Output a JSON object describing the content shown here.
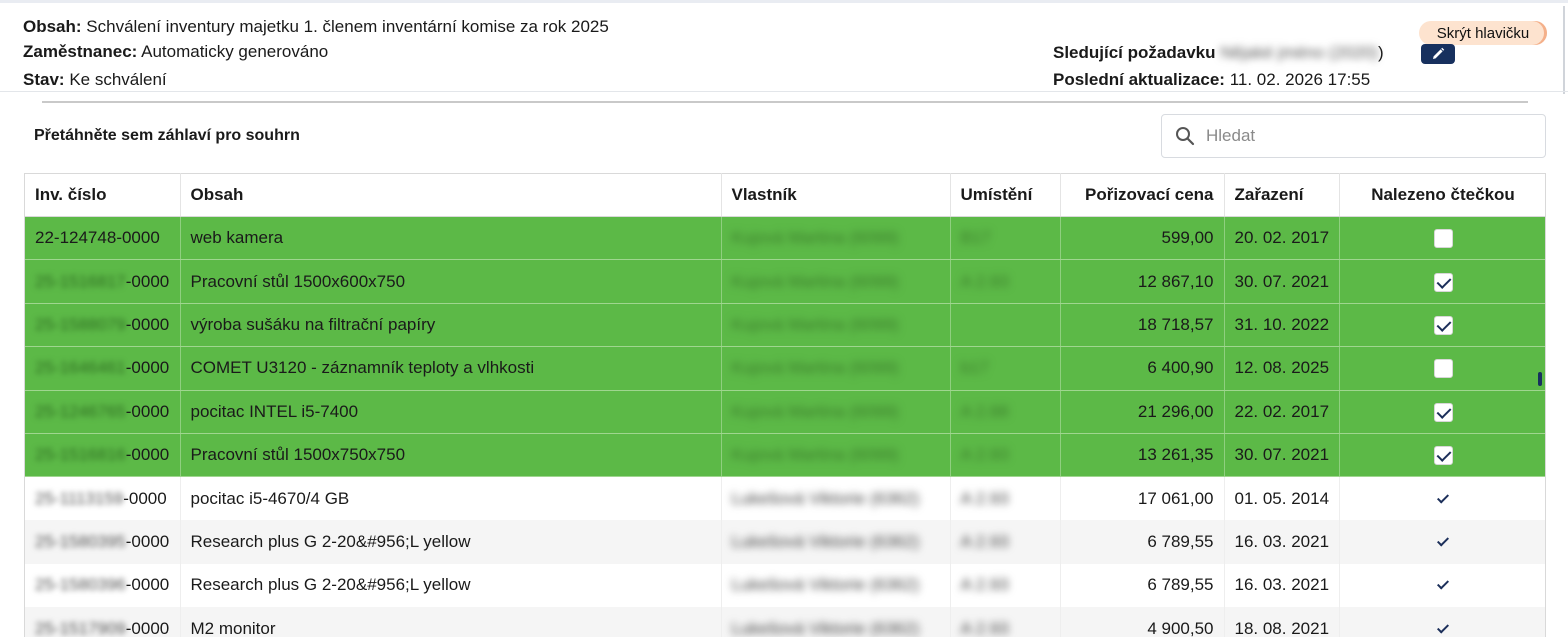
{
  "header": {
    "obsah_label": "Obsah:",
    "obsah_value": "Schválení inventury majetku 1. členem inventární komise za rok 2025",
    "zamestnanec_label": "Zaměstnanec:",
    "zamestnanec_value": "Automaticky generováno",
    "stav_label": "Stav:",
    "stav_value": "Ke schválení",
    "hide_button": "Skrýt hlavičku",
    "watcher_label": "Sledující požadavku",
    "watcher_value": "Nějaké jméno (2020)",
    "watcher_close_paren": ")",
    "updated_label": "Poslední aktualizace:",
    "updated_value": "11. 02. 2026 17:55"
  },
  "toolbar": {
    "group_hint": "Přetáhněte sem záhlaví pro souhrn",
    "search_placeholder": "Hledat"
  },
  "table": {
    "columns": [
      "Inv. číslo",
      "Obsah",
      "Vlastník",
      "Umístění",
      "Pořizovací cena",
      "Zařazení",
      "Nalezeno čtečkou"
    ],
    "rows": [
      {
        "inv_prefix": "22-124748",
        "inv_suffix": "-0000",
        "obsah": "web kamera",
        "vlastnik": "Kujová Martina (6099)",
        "umisteni": "B17",
        "cena": "599,00",
        "zarazeni": "20. 02. 2017",
        "nalezeno": false,
        "style": "green",
        "inv_prefix_blurred": false
      },
      {
        "inv_prefix": "25-1516817",
        "inv_suffix": "-0000",
        "obsah": "Pracovní stůl 1500x600x750",
        "vlastnik": "Kujová Martina (6099)",
        "umisteni": "A 2.93",
        "cena": "12 867,10",
        "zarazeni": "30. 07. 2021",
        "nalezeno": true,
        "style": "green",
        "inv_prefix_blurred": true
      },
      {
        "inv_prefix": "25-1588079",
        "inv_suffix": "-0000",
        "obsah": "výroba sušáku na filtrační papíry",
        "vlastnik": "Kujová Martina (6099)",
        "umisteni": "",
        "cena": "18 718,57",
        "zarazeni": "31. 10. 2022",
        "nalezeno": true,
        "style": "green",
        "inv_prefix_blurred": true
      },
      {
        "inv_prefix": "25-1646461",
        "inv_suffix": "-0000",
        "obsah": "COMET U3120 - záznamník teploty a vlhkosti",
        "vlastnik": "Kujová Martina (6099)",
        "umisteni": "b17",
        "cena": "6 400,90",
        "zarazeni": "12. 08. 2025",
        "nalezeno": false,
        "style": "green",
        "inv_prefix_blurred": true
      },
      {
        "inv_prefix": "25-1246765",
        "inv_suffix": "-0000",
        "obsah": "pocitac INTEL i5-7400",
        "vlastnik": "Kujová Martina (6099)",
        "umisteni": "A 2.88",
        "cena": "21 296,00",
        "zarazeni": "22. 02. 2017",
        "nalezeno": true,
        "style": "green",
        "inv_prefix_blurred": true
      },
      {
        "inv_prefix": "25-1516816",
        "inv_suffix": "-0000",
        "obsah": "Pracovní stůl 1500x750x750",
        "vlastnik": "Kujová Martina (6099)",
        "umisteni": "A 2.93",
        "cena": "13 261,35",
        "zarazeni": "30. 07. 2021",
        "nalezeno": true,
        "style": "green",
        "inv_prefix_blurred": true
      },
      {
        "inv_prefix": "25-1113159",
        "inv_suffix": "-0000",
        "obsah": "pocitac i5-4670/4 GB",
        "vlastnik": "Lukešová Viktorie (6362)",
        "umisteni": "A 2.93",
        "cena": "17 061,00",
        "zarazeni": "01. 05. 2014",
        "nalezeno": true,
        "style": "white",
        "inv_prefix_blurred": true
      },
      {
        "inv_prefix": "25-1580395",
        "inv_suffix": "-0000",
        "obsah": "Research plus G 2-20&#956;L yellow",
        "vlastnik": "Lukešová Viktorie (6362)",
        "umisteni": "A 2.93",
        "cena": "6 789,55",
        "zarazeni": "16. 03. 2021",
        "nalezeno": true,
        "style": "grey",
        "inv_prefix_blurred": true
      },
      {
        "inv_prefix": "25-1580396",
        "inv_suffix": "-0000",
        "obsah": "Research plus G 2-20&#956;L yellow",
        "vlastnik": "Lukešová Viktorie (6362)",
        "umisteni": "A 2.93",
        "cena": "6 789,55",
        "zarazeni": "16. 03. 2021",
        "nalezeno": true,
        "style": "white",
        "inv_prefix_blurred": true
      },
      {
        "inv_prefix": "25-1517909",
        "inv_suffix": "-0000",
        "obsah": "M2 monitor",
        "vlastnik": "Lukešová Viktorie (6362)",
        "umisteni": "A 2.93",
        "cena": "4 900,50",
        "zarazeni": "18. 08. 2021",
        "nalezeno": true,
        "style": "grey",
        "inv_prefix_blurred": true
      }
    ]
  },
  "colors": {
    "found_row": "#5cb947",
    "accent_dark": "#17305e",
    "hide_button_bg": "#fde3cf"
  },
  "icons": {
    "search": "search-icon",
    "edit": "pencil-icon",
    "check": "check-icon"
  }
}
